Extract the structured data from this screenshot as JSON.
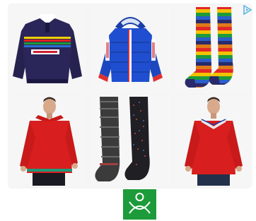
{
  "ad": {
    "choices_icon": "ad-choices-triangle-icon",
    "accent_color": "#5ab4e0"
  },
  "products": [
    {
      "id": "rugby-shirt",
      "kind": "navy-rugby-shirt-icon"
    },
    {
      "id": "puffer-jacket",
      "kind": "blue-puffer-jacket-icon"
    },
    {
      "id": "striped-socks",
      "kind": "rainbow-striped-socks-icon"
    },
    {
      "id": "red-sweater-man",
      "kind": "man-red-sweater-icon"
    },
    {
      "id": "dark-socks",
      "kind": "dark-socks-pair-icon"
    },
    {
      "id": "red-sweater-man-2",
      "kind": "man-red-sweater-collar-icon"
    }
  ],
  "brand": {
    "logo_icon": "benetton-green-logo-icon",
    "color": "#1d9b3a"
  }
}
